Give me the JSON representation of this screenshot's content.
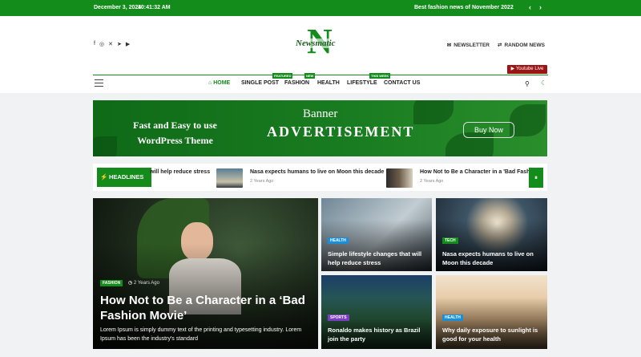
{
  "topbar": {
    "date": "December 3, 2024",
    "time": "10:41:32 AM",
    "headline": "Best fashion news of November 2022",
    "prev_icon": "chevron-left-icon",
    "next_icon": "chevron-right-icon"
  },
  "header": {
    "social_icons": [
      "facebook-icon",
      "instagram-icon",
      "x-icon",
      "telegram-icon",
      "youtube-icon"
    ],
    "logo_text": "Newsmatic",
    "logo_letter": "N",
    "newsletter": "NEWSLETTER",
    "random_news": "RANDOM NEWS",
    "youtube_live": "Youtube Live"
  },
  "nav": {
    "items": [
      {
        "label": "HOME"
      },
      {
        "label": "SINGLE POST"
      },
      {
        "label": "FASHION",
        "tag": "FEATURED"
      },
      {
        "label": "HEALTH",
        "tag": "NEW"
      },
      {
        "label": "LIFESTYLE",
        "tag": "THIS WEEK"
      },
      {
        "label": "CONTACT US"
      }
    ]
  },
  "banner": {
    "line1": "Fast and Easy to use WordPress Theme",
    "line2": "Banner",
    "line3": "ADVERTISEMENT",
    "cta": "Buy Now"
  },
  "ticker": {
    "label": "HEADLINES",
    "items": [
      {
        "title": "will help reduce stress",
        "date": ""
      },
      {
        "title": "Nasa expects humans to live on Moon this decade",
        "date": "2 Years Ago"
      },
      {
        "title": "How Not to Be a Character in a 'Bad Fashion",
        "date": "2 Years Ago"
      }
    ]
  },
  "featured": {
    "category": "FASHION",
    "date": "2 Years Ago",
    "title": "How Not to Be a Character in a ‘Bad Fashion Movie’",
    "excerpt": "Lorem Ipsum is simply dummy text of the printing and typesetting industry. Lorem Ipsum has been the industry's standard"
  },
  "grid": [
    {
      "category": "HEALTH",
      "title": "Simple lifestyle changes that will help reduce stress"
    },
    {
      "category": "TECH",
      "title": "Nasa expects humans to live on Moon this decade"
    },
    {
      "category": "SPORTS",
      "title": "Ronaldo makes history as Brazil join the party"
    },
    {
      "category": "HEALTH",
      "title": "Why daily exposure to sunlight is good for your health"
    }
  ],
  "colors": {
    "brand": "#148c1c",
    "youtube": "#9c1414",
    "sports": "#7b3fc4",
    "tech": "#148c1c",
    "health": "#1a8fd8"
  }
}
